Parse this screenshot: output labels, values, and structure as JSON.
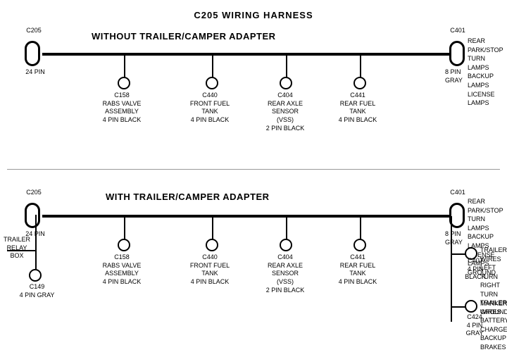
{
  "page": {
    "title": "C205 WIRING HARNESS"
  },
  "section1": {
    "title": "WITHOUT  TRAILER/CAMPER  ADAPTER",
    "connectors": {
      "left": {
        "label": "C205",
        "pin": "24 PIN"
      },
      "right": {
        "label": "C401",
        "pin": "8 PIN\nGRAY",
        "desc": "REAR PARK/STOP\nTURN LAMPS\nBACKUP LAMPS\nLICENSE LAMPS"
      }
    },
    "drops": [
      {
        "id": "C158",
        "label": "C158\nRABS VALVE\nASSEMBLY\n4 PIN BLACK"
      },
      {
        "id": "C440",
        "label": "C440\nFRONT FUEL\nTANK\n4 PIN BLACK"
      },
      {
        "id": "C404",
        "label": "C404\nREAR AXLE\nSENSOR\n(VSS)\n2 PIN BLACK"
      },
      {
        "id": "C441",
        "label": "C441\nREAR FUEL\nTANK\n4 PIN BLACK"
      }
    ]
  },
  "section2": {
    "title": "WITH  TRAILER/CAMPER  ADAPTER",
    "connectors": {
      "left": {
        "label": "C205",
        "pin": "24 PIN"
      },
      "right": {
        "label": "C401",
        "pin": "8 PIN\nGRAY",
        "desc": "REAR PARK/STOP\nTURN LAMPS\nBACKUP LAMPS\nLICENSE LAMPS\nGROUND"
      }
    },
    "extra_left": {
      "relay": "TRAILER\nRELAY\nBOX",
      "connector": {
        "id": "C149",
        "pin": "4 PIN GRAY"
      }
    },
    "drops": [
      {
        "id": "C158",
        "label": "C158\nRABS VALVE\nASSEMBLY\n4 PIN BLACK"
      },
      {
        "id": "C440",
        "label": "C440\nFRONT FUEL\nTANK\n4 PIN BLACK"
      },
      {
        "id": "C404",
        "label": "C404\nREAR AXLE\nSENSOR\n(VSS)\n2 PIN BLACK"
      },
      {
        "id": "C441",
        "label": "C441\nREAR FUEL\nTANK\n4 PIN BLACK"
      }
    ],
    "right_connectors": [
      {
        "id": "C407",
        "pin": "4 PIN\nBLACK",
        "desc": "TRAILER WIRES\nLEFT TURN\nRIGHT TURN\nMARKER\nGROUND"
      },
      {
        "id": "C424",
        "pin": "4 PIN\nGRAY",
        "desc": "TRAILER WIRES\nBATTERY CHARGE\nBACKUP\nBRAKES"
      }
    ]
  }
}
